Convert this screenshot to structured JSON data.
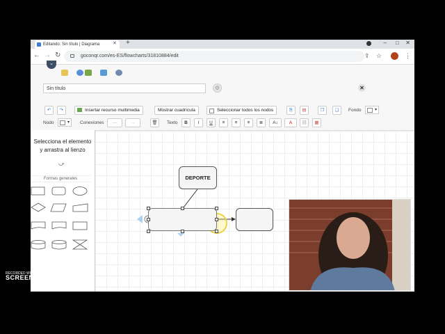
{
  "browser": {
    "tab_title": "Editando: Sin título | Diagrama",
    "url": "goconqr.com/es-ES/flowcharts/31810884/edit"
  },
  "editor": {
    "title_value": "Sin título"
  },
  "toolbar": {
    "insert_media": "Insertar recurso multimedia",
    "show_grid": "Mostrar cuadrícula",
    "select_all": "Seleccionar todos los nodos",
    "fondo_label": "Fondo",
    "nodo_label": "Nodo",
    "conexiones_label": "Conexiones",
    "texto_label": "Texto",
    "bold": "B",
    "italic": "I",
    "underline": "U",
    "font_size": "A↕"
  },
  "sidebar": {
    "instruction_line1": "Selecciona el elemento",
    "instruction_line2": "y arrastra al lienzo",
    "section_title": "Formas generales"
  },
  "canvas": {
    "node_deporte": "DEPORTE"
  },
  "recorder": {
    "line1": "RECORDED WITH",
    "line2": "SCREENCAST",
    "line3": "MATIC"
  },
  "colors": {
    "accent": "#3a7bd5",
    "selection_blue": "#9ec5f0"
  },
  "icons": [
    "back-icon",
    "forward-icon",
    "reload-icon",
    "lock-icon",
    "star-icon",
    "menu-icon",
    "undo-icon",
    "redo-icon",
    "gear-icon",
    "close-icon",
    "trash-icon"
  ]
}
